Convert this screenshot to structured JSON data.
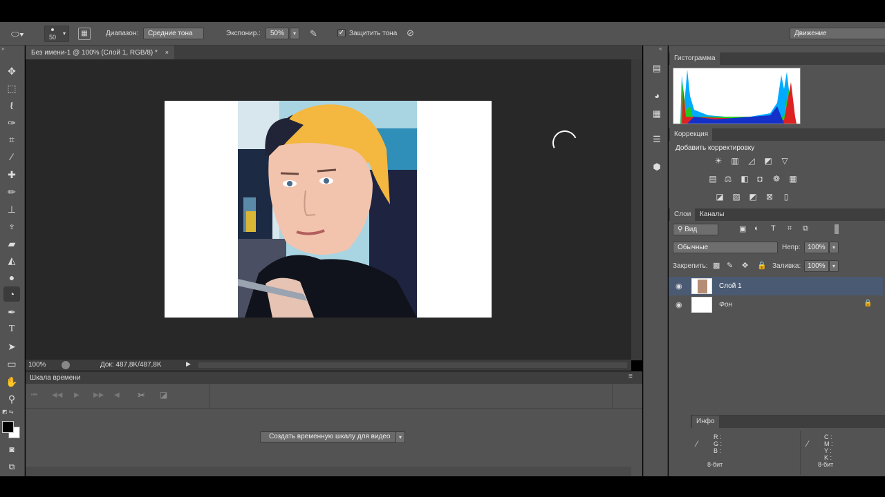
{
  "options": {
    "brush_size": "50",
    "range_label": "Диапазон:",
    "range_value": "Средние тона",
    "exposure_label": "Экспонир.:",
    "exposure_value": "50%",
    "protect_label": "Защитить тона",
    "protect_checked": true,
    "workspace": "Движение"
  },
  "document": {
    "tab_title": "Без имени-1 @ 100% (Слой 1, RGB/8) *",
    "zoom": "100%",
    "doc_size": "Док: 487,8K/487,8K"
  },
  "timeline": {
    "title": "Шкала времени",
    "create_button": "Создать временную шкалу для видео"
  },
  "panels": {
    "histogram_tab": "Гистограмма",
    "adjustments_tab": "Коррекция",
    "adjustments_title": "Добавить корректировку",
    "layers_tab": "Слои",
    "channels_tab": "Каналы",
    "filter_kind": "Вид",
    "blend_mode": "Обычные",
    "opacity_label": "Непр:",
    "opacity_value": "100%",
    "lock_label": "Закрепить:",
    "fill_label": "Заливка:",
    "fill_value": "100%",
    "layers": [
      {
        "name": "Слой 1",
        "selected": true
      },
      {
        "name": "Фон",
        "selected": false,
        "locked": true
      }
    ],
    "info_tab": "Инфо",
    "info_rgb": [
      "R :",
      "G :",
      "B :"
    ],
    "info_cmyk": [
      "C :",
      "M :",
      "Y :",
      "K :"
    ],
    "bit_depth_1": "8-бит",
    "bit_depth_2": "8-бит"
  },
  "colors": {
    "ui_bg": "#535353",
    "canvas_bg": "#282828",
    "selected_layer": "#4b5a73"
  }
}
